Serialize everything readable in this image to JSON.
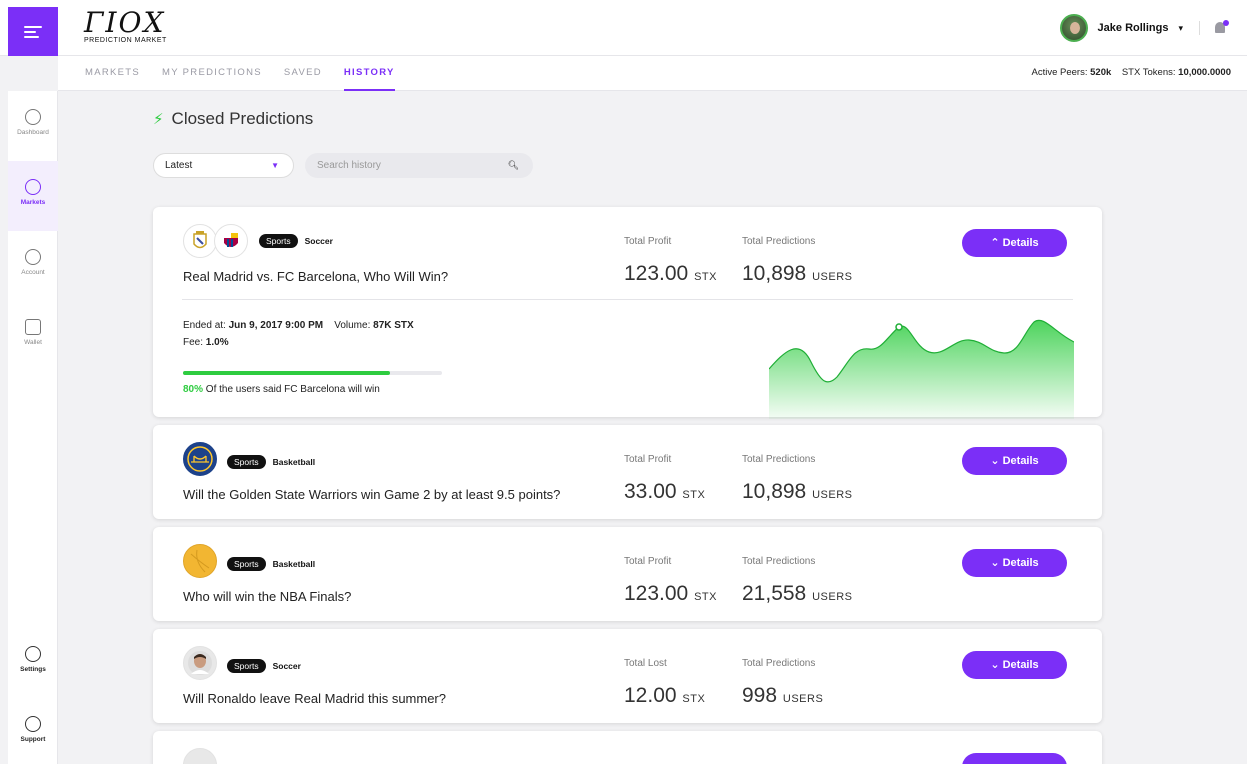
{
  "topbar": {
    "logo_mark": "ΓΙΟΧ",
    "logo_sub": "PREDICTION MARKET",
    "user_name": "Jake Rollings"
  },
  "subnav": {
    "tabs": [
      {
        "label": "MARKETS"
      },
      {
        "label": "MY PREDICTIONS"
      },
      {
        "label": "SAVED"
      },
      {
        "label": "HISTORY"
      }
    ],
    "active_peers_label": "Active Peers:",
    "active_peers_value": "520k",
    "tokens_label": "STX Tokens:",
    "tokens_value": "10,000.0000"
  },
  "sidebar": {
    "items": [
      {
        "label": "Dashboard"
      },
      {
        "label": "Markets"
      },
      {
        "label": "Account"
      },
      {
        "label": "Wallet"
      }
    ],
    "bottom": [
      {
        "label": "Settings"
      },
      {
        "label": "Support"
      }
    ]
  },
  "main": {
    "title": "Closed Predictions",
    "sort_value": "Latest",
    "search_placeholder": "Search history"
  },
  "cards": [
    {
      "tag": "Sports",
      "sport": "Soccer",
      "question": "Real Madrid vs. FC Barcelona, Who Will Win?",
      "metric1_label": "Total Profit",
      "metric1_value": "123.00",
      "metric1_unit": "STX",
      "metric2_label": "Total Predictions",
      "metric2_value": "10,898",
      "metric2_unit": "USERS",
      "details_label": "Details",
      "ended_label": "Ended at:",
      "ended_value": "Jun 9, 2017 9:00 PM",
      "volume_label": "Volume:",
      "volume_value": "87K STX",
      "fee_label": "Fee:",
      "fee_value": "1.0%",
      "poll_percent": "80%",
      "poll_text": "Of the users said FC Barcelona will win",
      "poll_fraction": 0.8
    },
    {
      "tag": "Sports",
      "sport": "Basketball",
      "question": "Will the Golden State Warriors win Game 2 by at least 9.5 points?",
      "metric1_label": "Total Profit",
      "metric1_value": "33.00",
      "metric1_unit": "STX",
      "metric2_label": "Total Predictions",
      "metric2_value": "10,898",
      "metric2_unit": "USERS",
      "details_label": "Details"
    },
    {
      "tag": "Sports",
      "sport": "Basketball",
      "question": "Who will win the NBA Finals?",
      "metric1_label": "Total Profit",
      "metric1_value": "123.00",
      "metric1_unit": "STX",
      "metric2_label": "Total Predictions",
      "metric2_value": "21,558",
      "metric2_unit": "USERS",
      "details_label": "Details"
    },
    {
      "tag": "Sports",
      "sport": "Soccer",
      "question": "Will Ronaldo leave Real Madrid this summer?",
      "metric1_label": "Total Lost",
      "metric1_value": "12.00",
      "metric1_unit": "STX",
      "metric2_label": "Total Predictions",
      "metric2_value": "998",
      "metric2_unit": "USERS",
      "details_label": "Details"
    }
  ],
  "colors": {
    "accent": "#7b2ff7",
    "positive": "#2ecc40"
  }
}
